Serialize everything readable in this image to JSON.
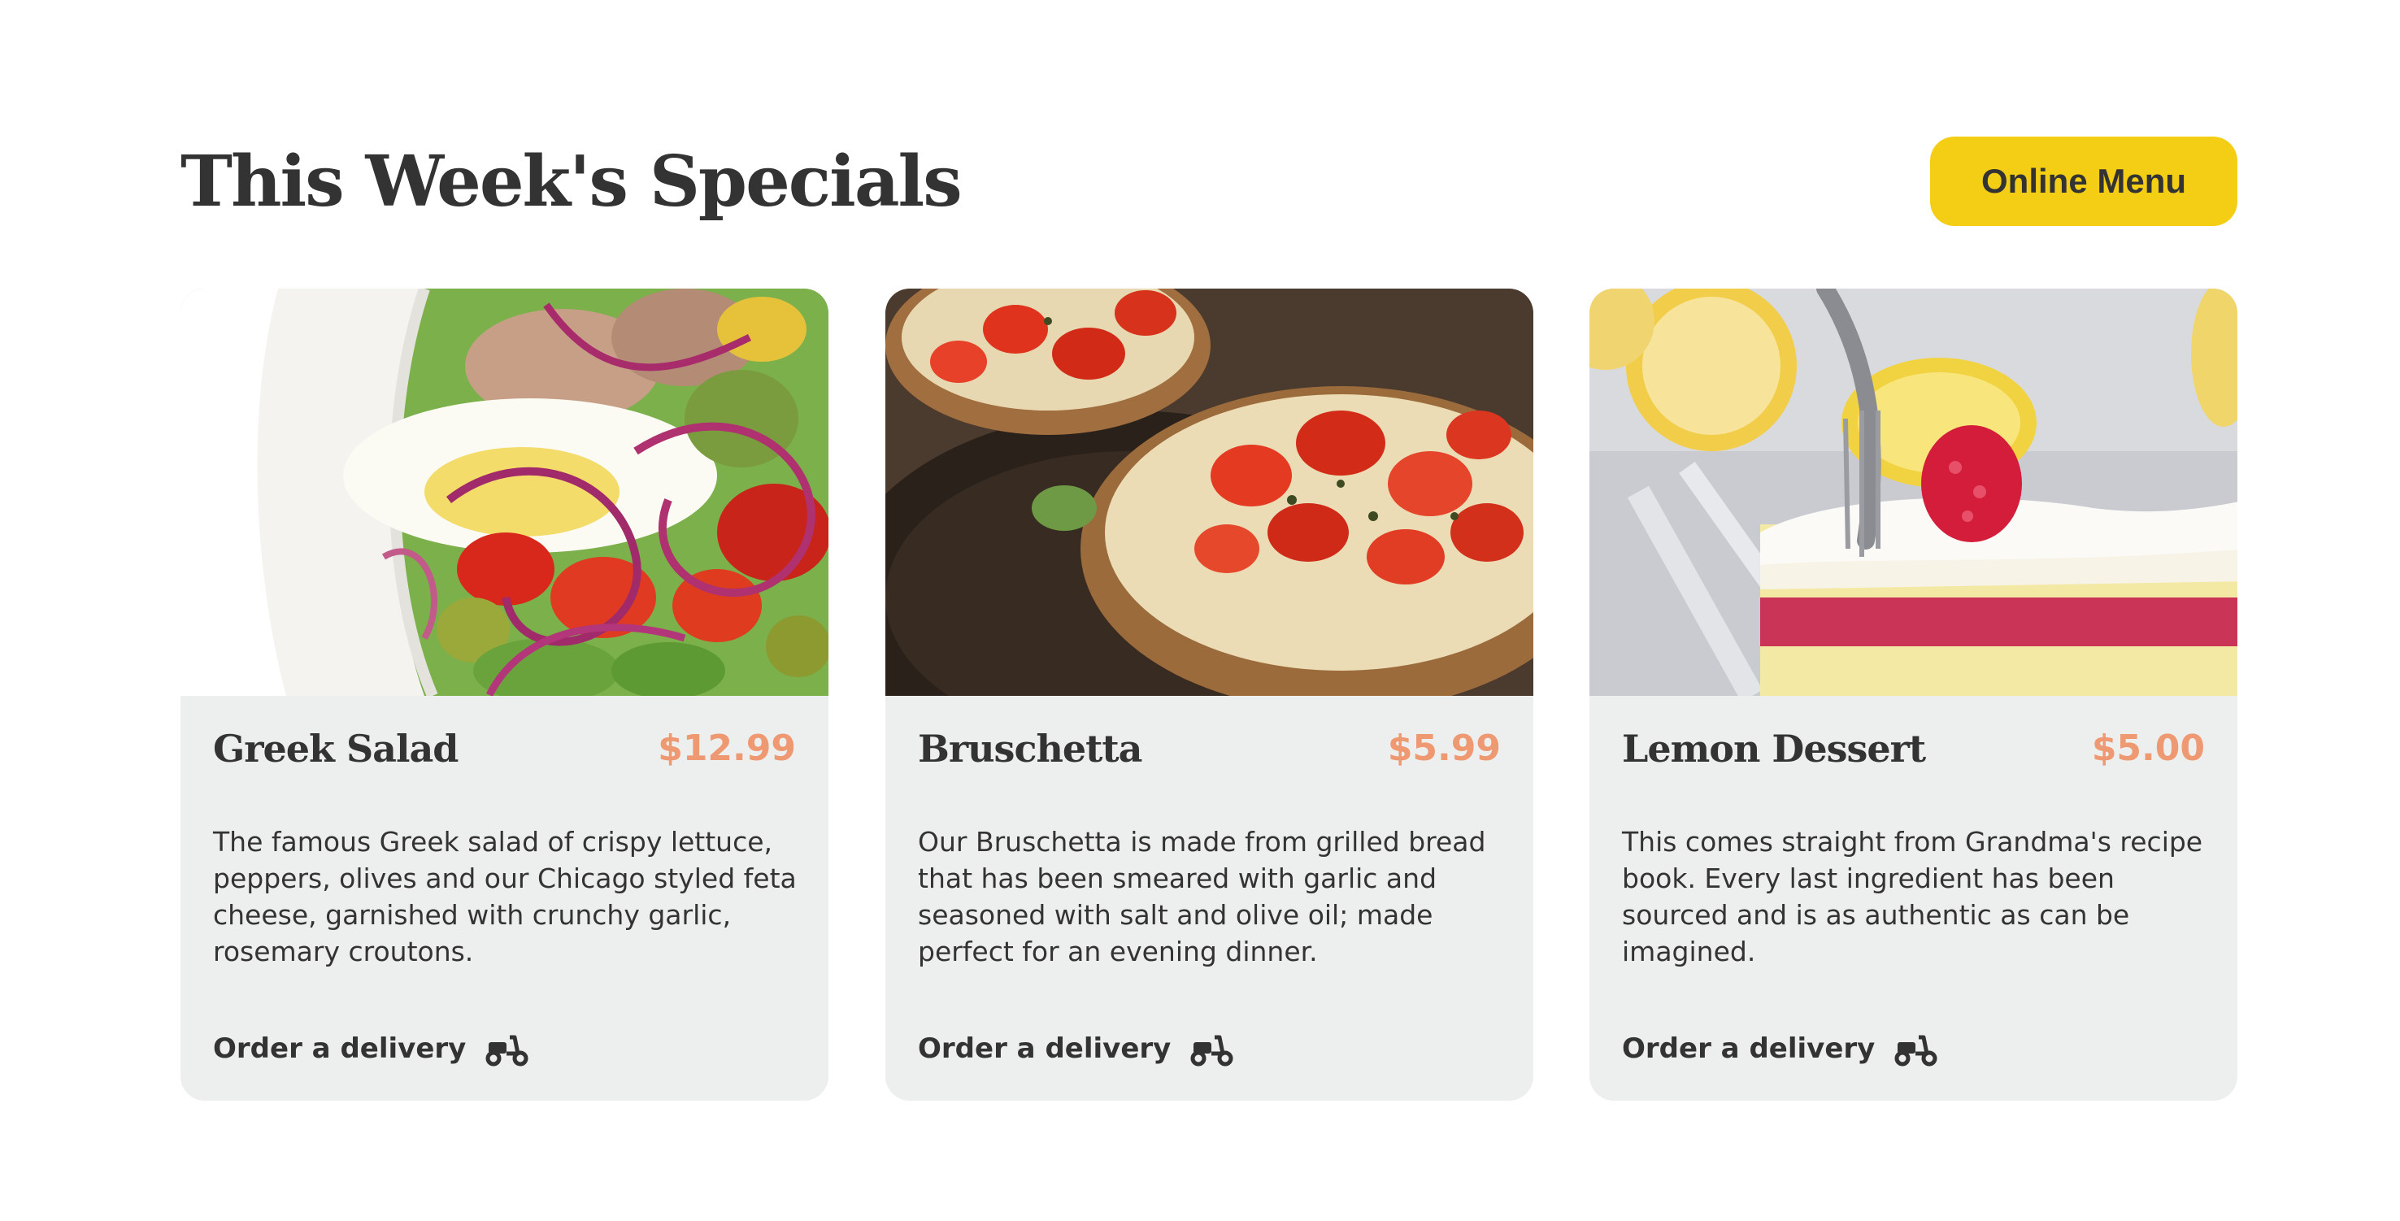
{
  "header": {
    "title": "This Week's Specials",
    "menu_button_label": "Online Menu"
  },
  "colors": {
    "accent_yellow": "#F4CE14",
    "price_salmon": "#EE9972",
    "card_background": "#EDEFEE",
    "text_dark": "#333333"
  },
  "cards": [
    {
      "image": "greek-salad-photo",
      "name": "Greek Salad",
      "price": "$12.99",
      "description": "The famous Greek salad of crispy lettuce, peppers, olives and our Chicago styled feta cheese, garnished with crunchy garlic, rosemary croutons.",
      "order_label": "Order a delivery",
      "order_icon": "scooter-icon"
    },
    {
      "image": "bruschetta-photo",
      "name": "Bruschetta",
      "price": "$5.99",
      "description": "Our Bruschetta is made from grilled bread that has been smeared with garlic and seasoned with salt and olive oil; made perfect for an evening dinner.",
      "order_label": "Order a delivery",
      "order_icon": "scooter-icon"
    },
    {
      "image": "lemon-dessert-photo",
      "name": "Lemon Dessert",
      "price": "$5.00",
      "description": "This comes straight from Grandma's recipe book. Every last ingredient has been sourced and is as authentic as can be imagined.",
      "order_label": "Order a delivery",
      "order_icon": "scooter-icon"
    }
  ]
}
